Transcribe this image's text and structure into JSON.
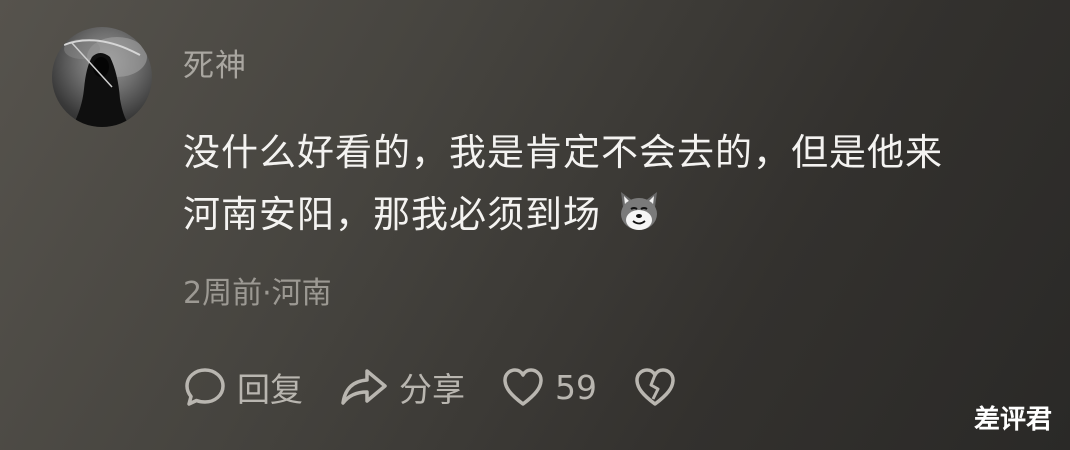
{
  "comment": {
    "username": "死神",
    "text_line1": "没什么好看的，我是肯定不会去的，但是他来",
    "text_line2": "河南安阳，那我必须到场",
    "emoji_icon": "dog-face-emoji",
    "meta": "2周前·河南"
  },
  "actions": {
    "reply_label": "回复",
    "share_label": "分享",
    "like_count": "59"
  },
  "watermark": "差评君",
  "colors": {
    "background_light": "#56534d",
    "background_dark": "#2a2927",
    "username": "#a9a6a0",
    "body_text": "#f4f3f1",
    "meta": "#9c9993",
    "icon": "#b9b6b0"
  }
}
